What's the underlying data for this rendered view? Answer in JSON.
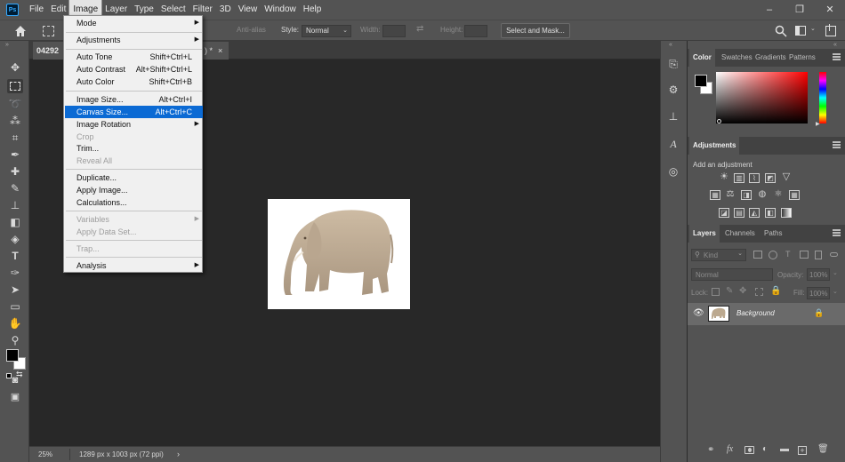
{
  "menubar": {
    "items": [
      "File",
      "Edit",
      "Image",
      "Layer",
      "Type",
      "Select",
      "Filter",
      "3D",
      "View",
      "Window",
      "Help"
    ],
    "active": "Image",
    "window_controls": [
      "–",
      "❐",
      "✕"
    ]
  },
  "options_bar": {
    "anti_alias": "Anti-alias",
    "style_label": "Style:",
    "style_value": "Normal",
    "width_label": "Width:",
    "height_label": "Height:",
    "select_mask": "Select and Mask..."
  },
  "document": {
    "tab_prefix": "04292",
    "tab_suffix": ") *",
    "close": "×",
    "zoom": "25%",
    "size_info": "1289 px x 1003 px (72 ppi)",
    "status_arrow": "›"
  },
  "image_menu": {
    "items": [
      {
        "label": "Mode",
        "shortcut": "",
        "submenu": true,
        "disabled": false
      },
      {
        "label": "Adjustments",
        "shortcut": "",
        "submenu": true,
        "disabled": false
      },
      {
        "label": "Auto Tone",
        "shortcut": "Shift+Ctrl+L",
        "submenu": false,
        "disabled": false
      },
      {
        "label": "Auto Contrast",
        "shortcut": "Alt+Shift+Ctrl+L",
        "submenu": false,
        "disabled": false
      },
      {
        "label": "Auto Color",
        "shortcut": "Shift+Ctrl+B",
        "submenu": false,
        "disabled": false
      },
      {
        "label": "Image Size...",
        "shortcut": "Alt+Ctrl+I",
        "submenu": false,
        "disabled": false
      },
      {
        "label": "Canvas Size...",
        "shortcut": "Alt+Ctrl+C",
        "submenu": false,
        "disabled": false,
        "highlighted": true
      },
      {
        "label": "Image Rotation",
        "shortcut": "",
        "submenu": true,
        "disabled": false
      },
      {
        "label": "Crop",
        "shortcut": "",
        "submenu": false,
        "disabled": true
      },
      {
        "label": "Trim...",
        "shortcut": "",
        "submenu": false,
        "disabled": false
      },
      {
        "label": "Reveal All",
        "shortcut": "",
        "submenu": false,
        "disabled": true
      },
      {
        "label": "Duplicate...",
        "shortcut": "",
        "submenu": false,
        "disabled": false
      },
      {
        "label": "Apply Image...",
        "shortcut": "",
        "submenu": false,
        "disabled": false
      },
      {
        "label": "Calculations...",
        "shortcut": "",
        "submenu": false,
        "disabled": false
      },
      {
        "label": "Variables",
        "shortcut": "",
        "submenu": true,
        "disabled": true
      },
      {
        "label": "Apply Data Set...",
        "shortcut": "",
        "submenu": false,
        "disabled": true
      },
      {
        "label": "Trap...",
        "shortcut": "",
        "submenu": false,
        "disabled": true
      },
      {
        "label": "Analysis",
        "shortcut": "",
        "submenu": true,
        "disabled": false
      }
    ]
  },
  "color_panel": {
    "tabs": [
      "Color",
      "Swatches",
      "Gradients",
      "Patterns"
    ],
    "active_tab": "Color",
    "hue_color": "#ff0000"
  },
  "adjustments_panel": {
    "tab": "Adjustments",
    "add_label": "Add an adjustment"
  },
  "layers_panel": {
    "tabs": [
      "Layers",
      "Channels",
      "Paths"
    ],
    "active_tab": "Layers",
    "kind_placeholder": "Kind",
    "blend_mode": "Normal",
    "opacity_label": "Opacity:",
    "opacity_value": "100%",
    "lock_label": "Lock:",
    "fill_label": "Fill:",
    "fill_value": "100%",
    "layers": [
      {
        "name": "Background",
        "visible": true,
        "locked": true
      }
    ]
  }
}
